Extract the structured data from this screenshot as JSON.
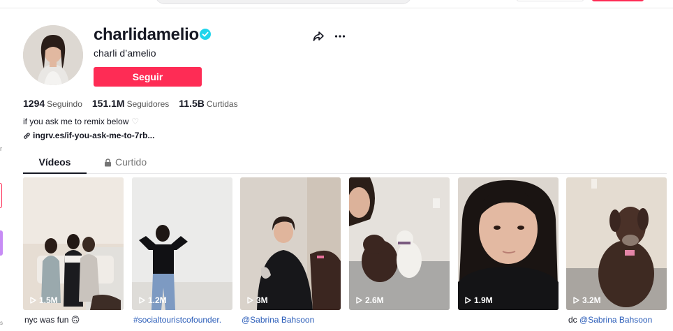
{
  "profile": {
    "username": "charlidamelio",
    "nickname": "charli d’amelio",
    "follow_label": "Seguir",
    "verified": true
  },
  "stats": [
    {
      "value": "1294",
      "label": "Seguindo"
    },
    {
      "value": "151.1M",
      "label": "Seguidores"
    },
    {
      "value": "11.5B",
      "label": "Curtidas"
    }
  ],
  "bio": {
    "text": "if you ask me to remix below",
    "heart": "♡",
    "link": "ingrv.es/if-you-ask-me-to-7rb..."
  },
  "tabs": {
    "videos": "Vídeos",
    "liked": "Curtido"
  },
  "videos": [
    {
      "views": "1.5M",
      "caption": "nyc was fun 🙃",
      "tag": ""
    },
    {
      "views": "1.2M",
      "caption": "",
      "tag": "#socialtouristcofounder."
    },
    {
      "views": "3M",
      "caption": "",
      "tag": "@Sabrina Bahsoon"
    },
    {
      "views": "2.6M",
      "caption": "",
      "tag": ""
    },
    {
      "views": "1.9M",
      "caption": "",
      "tag": ""
    },
    {
      "views": "3.2M",
      "caption": "dc ",
      "tag": "@Sabrina Bahsoon"
    }
  ],
  "colors": {
    "accent": "#fe2c55",
    "verified": "#20d5ec",
    "mention": "#2b5db9",
    "text": "#161823"
  },
  "icons": [
    "verified-badge-icon",
    "share-icon",
    "more-icon",
    "link-icon",
    "lock-icon",
    "play-icon"
  ]
}
